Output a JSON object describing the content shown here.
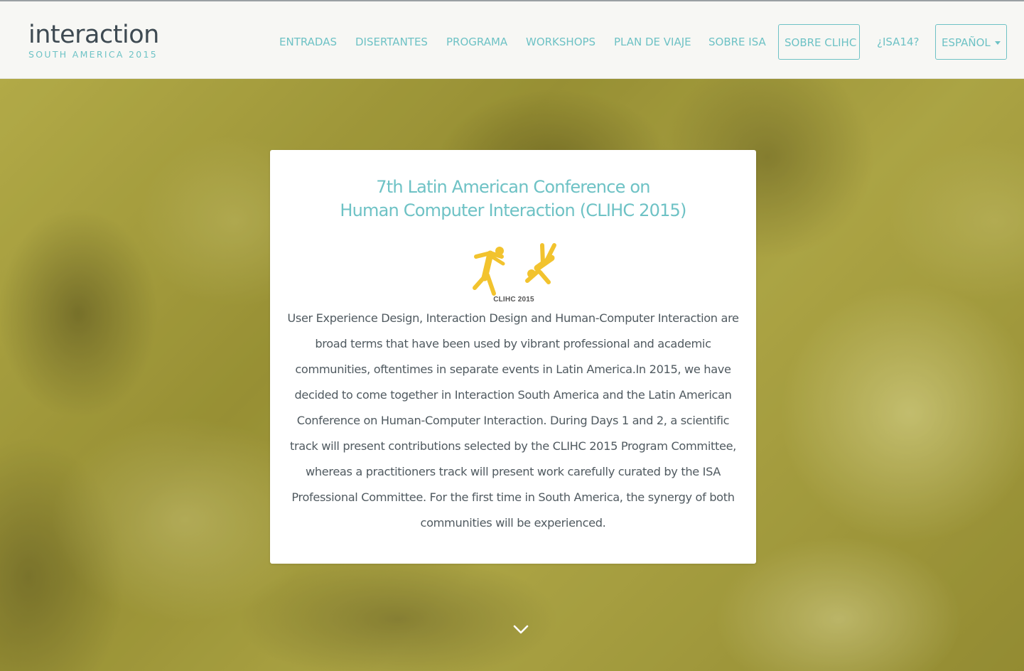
{
  "brand": {
    "name": "interaction",
    "subtitle": "SOUTH AMERICA 2015"
  },
  "nav": {
    "items": [
      {
        "label": "ENTRADAS"
      },
      {
        "label": "DISERTANTES"
      },
      {
        "label": "PROGRAMA"
      },
      {
        "label": "WORKSHOPS"
      },
      {
        "label": "PLAN DE VIAJE"
      },
      {
        "label": "SOBRE ISA"
      },
      {
        "label": "SOBRE CLIHC",
        "active": true
      },
      {
        "label": "¿ISA14?"
      }
    ],
    "language": {
      "label": "ESPAÑOL"
    }
  },
  "hero": {
    "card": {
      "title_line1": "7th Latin American Conference on",
      "title_line2": "Human Computer Interaction (CLIHC 2015)",
      "logo_caption": "CLIHC 2015",
      "body": "User Experience Design, Interaction Design and Human-Computer Interaction are broad terms that have been used by vibrant professional and academic communities, oftentimes in separate events in Latin America.In 2015, we have decided to come together in Interaction South America and the Latin American Conference on Human-Computer Interaction. During Days 1 and 2, a scientific track will present contributions selected by the CLIHC 2015 Program Committee, whereas a practitioners track will present work carefully curated by the ISA Professional Committee. For the first time in South America, the synergy of both communities will be experienced."
    },
    "scroll_icon": "chevron-down-icon"
  },
  "colors": {
    "accent": "#6ec2c5",
    "brand_text": "#3e4a52",
    "hero_tint": "#a59e3c",
    "logo_yellow": "#f2c32e",
    "body_text": "#505a60"
  }
}
